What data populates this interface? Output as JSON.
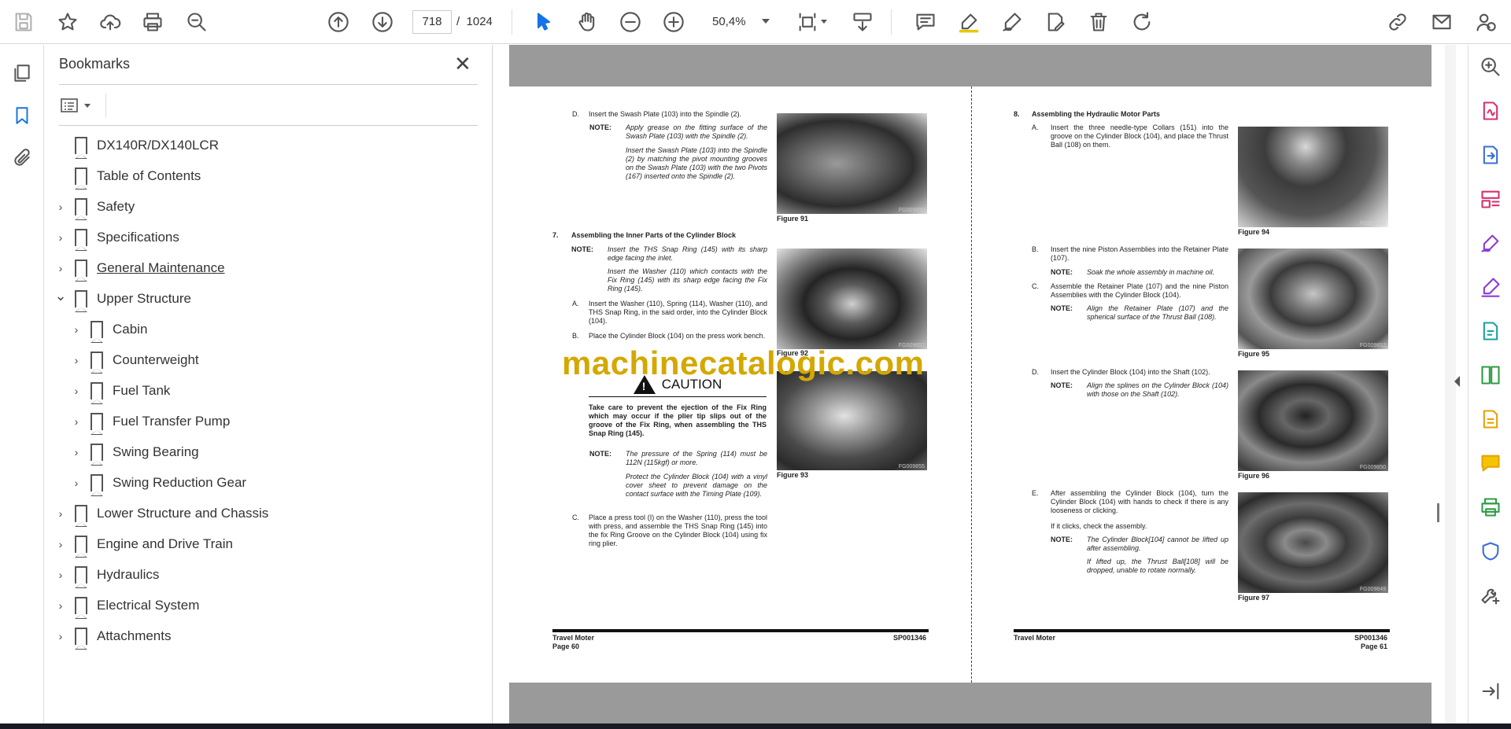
{
  "toolbar": {
    "current_page": "718",
    "page_separator": "/",
    "total_pages": "1024",
    "zoom": "50,4%"
  },
  "bookmarks_panel": {
    "title": "Bookmarks",
    "close_glyph": "✕",
    "items": [
      {
        "label": "DX140R/DX140LCR",
        "level": 0,
        "chevron": ""
      },
      {
        "label": "Table of Contents",
        "level": 0,
        "chevron": ""
      },
      {
        "label": "Safety",
        "level": 0,
        "chevron": "›"
      },
      {
        "label": "Specifications",
        "level": 0,
        "chevron": "›"
      },
      {
        "label": "General Maintenance",
        "level": 0,
        "chevron": "›"
      },
      {
        "label": "Upper Structure",
        "level": 0,
        "chevron": "⌄"
      },
      {
        "label": "Cabin",
        "level": 1,
        "chevron": "›"
      },
      {
        "label": "Counterweight",
        "level": 1,
        "chevron": "›"
      },
      {
        "label": "Fuel Tank",
        "level": 1,
        "chevron": "›"
      },
      {
        "label": "Fuel Transfer Pump",
        "level": 1,
        "chevron": "›"
      },
      {
        "label": "Swing Bearing",
        "level": 1,
        "chevron": "›"
      },
      {
        "label": "Swing Reduction Gear",
        "level": 1,
        "chevron": "›"
      },
      {
        "label": "Lower Structure and Chassis",
        "level": 0,
        "chevron": "›"
      },
      {
        "label": "Engine and Drive Train",
        "level": 0,
        "chevron": "›"
      },
      {
        "label": "Hydraulics",
        "level": 0,
        "chevron": "›"
      },
      {
        "label": "Electrical System",
        "level": 0,
        "chevron": "›"
      },
      {
        "label": "Attachments",
        "level": 0,
        "chevron": "›"
      }
    ]
  },
  "watermark": "machinecatalogic.com",
  "left_page": {
    "step_d": "D.",
    "step_d_text": "Insert the Swash Plate (103) into the Spindle (2).",
    "note1_label": "NOTE:",
    "note1_a": "Apply grease on the fitting surface of the Swash Plate (103) with the Spindle (2).",
    "note1_b": "Insert the Swash Plate (103) into the Spindle (2) by matching the pivot mounting grooves on the Swash Plate (103) with the two Pivots (167) inserted onto the Spindle (2).",
    "fig91_caption": "Figure 91",
    "fig91_code": "FG009856",
    "sec7_num": "7.",
    "sec7_title": "Assembling the Inner Parts of the Cylinder Block",
    "note2_label": "NOTE:",
    "note2_a": "Insert the THS Snap Ring (145) with its sharp edge facing the inlet.",
    "note2_b": "Insert the Washer (110) which contacts with the Fix Ring (145) with its sharp edge facing the Fix Ring (145).",
    "step_a": "A.",
    "step_a_text": "Insert the Washer (110), Spring (114), Washer (110), and THS Snap Ring, in the said order, into the Cylinder Block (104).",
    "step_b": "B.",
    "step_b_text": "Place the Cylinder Block (104) on the press work bench.",
    "fig92_caption": "Figure 92",
    "fig92_code": "FG009857",
    "caution_title": "CAUTION",
    "caution_text": "Take care to prevent the ejection of the Fix Ring which may occur if the plier tip slips out of the groove of the Fix Ring, when assembling the THS Snap Ring (145).",
    "note3_label": "NOTE:",
    "note3_a": "The pressure of the Spring (114) must be 112N (115kgf) or more.",
    "note3_b": "Protect the Cylinder Block (104) with a vinyl cover sheet to prevent damage on the contact surface with the Timing Plate (109).",
    "fig93_caption": "Figure 93",
    "fig93_code": "FG009855",
    "step_c": "C.",
    "step_c_text": "Place a press tool (I) on the Washer (110), press the tool with press, and assemble the THS Snap Ring (145) into the fix Ring Groove on the Cylinder Block (104) using fix ring plier.",
    "footer_title": "Travel Moter",
    "footer_page": "Page 60",
    "footer_code": "SP001346"
  },
  "right_page": {
    "sec8_num": "8.",
    "sec8_title": "Assembling the Hydraulic Motor Parts",
    "step_a": "A.",
    "step_a_text": "Insert the three needle-type Collars (151) into the groove on the Cylinder Block (104), and place the Thrust Ball (108) on them.",
    "fig94_caption": "Figure 94",
    "fig94_code": "FG009853",
    "step_b": "B.",
    "step_b_text": "Insert the nine Piston Assemblies into the Retainer Plate (107).",
    "note1_label": "NOTE:",
    "note1_a": "Soak the whole assembly in machine oil.",
    "step_c": "C.",
    "step_c_text": "Assemble the Retainer Plate (107) and the nine Piston Assemblies with the Cylinder Block (104).",
    "note2_label": "NOTE:",
    "note2_a": "Align the Retainer Plate (107) and the spherical surface of the Thrust Ball (108).",
    "fig95_caption": "Figure 95",
    "fig95_code": "FG009852",
    "step_d": "D.",
    "step_d_text": "Insert the Cylinder Block (104) into the Shaft (102).",
    "note3_label": "NOTE:",
    "note3_a": "Align the splines on the Cylinder Block (104) with those on the Shaft (102).",
    "fig96_caption": "Figure 96",
    "fig96_code": "FG009850",
    "step_e": "E.",
    "step_e_text": "After assembling the Cylinder Block (104), turn the Cylinder Block (104) with hands to check if there is any looseness or clicking.",
    "step_e_text2": "If it clicks, check the assembly.",
    "note4_label": "NOTE:",
    "note4_a": "The Cylinder Block[104] cannot be lifted up after assembling.",
    "note4_b": "If lifted up, the Thrust Ball[108] will be dropped, unable to rotate normally.",
    "fig97_caption": "Figure 97",
    "fig97_code": "FG009849",
    "footer_title": "Travel Moter",
    "footer_page": "Page 61",
    "footer_code": "SP001346"
  },
  "colors": {
    "accent": "#1473e6",
    "watermark": "#d4a800",
    "tools_pink": "#d6336c",
    "tools_purple": "#8b3cd6",
    "tools_green": "#2d9d43"
  }
}
